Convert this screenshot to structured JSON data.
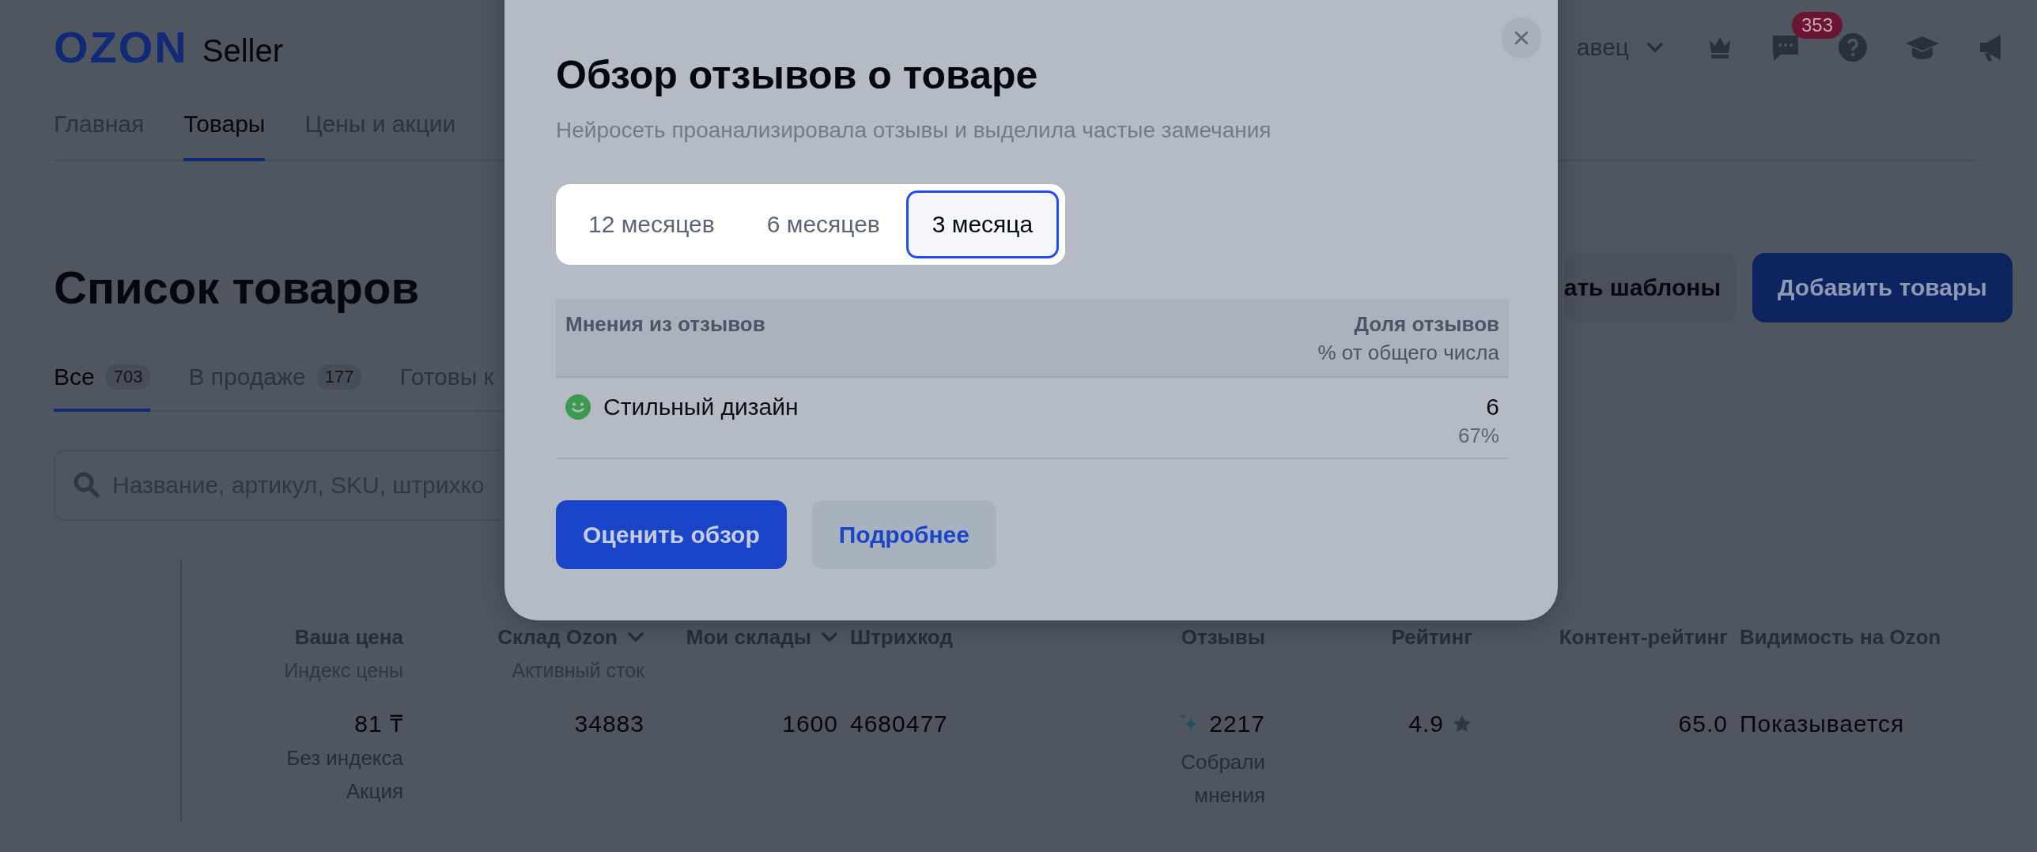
{
  "header": {
    "logo": "OZON",
    "logo_subtitle": "Seller",
    "account_name": "авец",
    "notifications_badge": "353"
  },
  "nav": [
    {
      "label": "Главная",
      "selected": false
    },
    {
      "label": "Товары",
      "selected": true
    },
    {
      "label": "Цены и акции",
      "selected": false
    }
  ],
  "page_title": "Список товаров",
  "actions": [
    {
      "label": "ать шаблоны",
      "kind": "secondary"
    },
    {
      "label": "Добавить товары",
      "kind": "primary"
    }
  ],
  "status_tabs": [
    {
      "label": "Все",
      "count": "703",
      "selected": true
    },
    {
      "label": "В продаже",
      "count": "177",
      "selected": false
    },
    {
      "label": "Готовы к",
      "selected": false
    }
  ],
  "search": {
    "placeholder": "Название, артикул, SKU, штрихко"
  },
  "table": {
    "columns": [
      {
        "title": "Ваша цена",
        "subtitle": "Индекс цены",
        "sortable": false
      },
      {
        "title": "Склад Ozon",
        "subtitle": "Активный сток",
        "sortable": true
      },
      {
        "title": "Мои склады",
        "sortable": true
      },
      {
        "title": "Штрихкод",
        "sortable": false
      },
      {
        "title": "Отзывы",
        "sortable": false
      },
      {
        "title": "Рейтинг",
        "sortable": false
      },
      {
        "title": "Контент-рейтинг",
        "sortable": false
      },
      {
        "title": "Видимость на Ozon",
        "sortable": false
      }
    ],
    "rows": [
      [
        {
          "kind": "price",
          "value": "81 ₸",
          "notes": [
            "Без индекса",
            "Акция"
          ]
        },
        {
          "kind": "number",
          "value": "34883"
        },
        {
          "kind": "number",
          "value": "1600"
        },
        {
          "kind": "number",
          "value": "4680477"
        },
        {
          "kind": "reviews",
          "value": "2217",
          "notes": [
            "Собрали мнения"
          ]
        },
        {
          "kind": "rating",
          "value": "4.9"
        },
        {
          "kind": "number",
          "value": "65.0"
        },
        {
          "kind": "text",
          "value": "Показывается"
        }
      ]
    ]
  },
  "modal": {
    "title": "Обзор отзывов о товаре",
    "subtitle": "Нейросеть проанализировала отзывы и выделила частые замечания",
    "periods": [
      {
        "label": "12 месяцев",
        "selected": false
      },
      {
        "label": "6 месяцев",
        "selected": false
      },
      {
        "label": "3 месяца",
        "selected": true
      }
    ],
    "columns": {
      "opinion": "Мнения из отзывов",
      "share": "Доля отзывов",
      "share_note": "% от общего числа"
    },
    "opinions": [
      {
        "text": "Стильный дизайн",
        "color": "#3c9a4e",
        "count": "6",
        "percent": "67%"
      }
    ],
    "buttons": [
      {
        "label": "Оценить обзор",
        "kind": "primary"
      },
      {
        "label": "Подробнее",
        "kind": "secondary"
      }
    ]
  }
}
